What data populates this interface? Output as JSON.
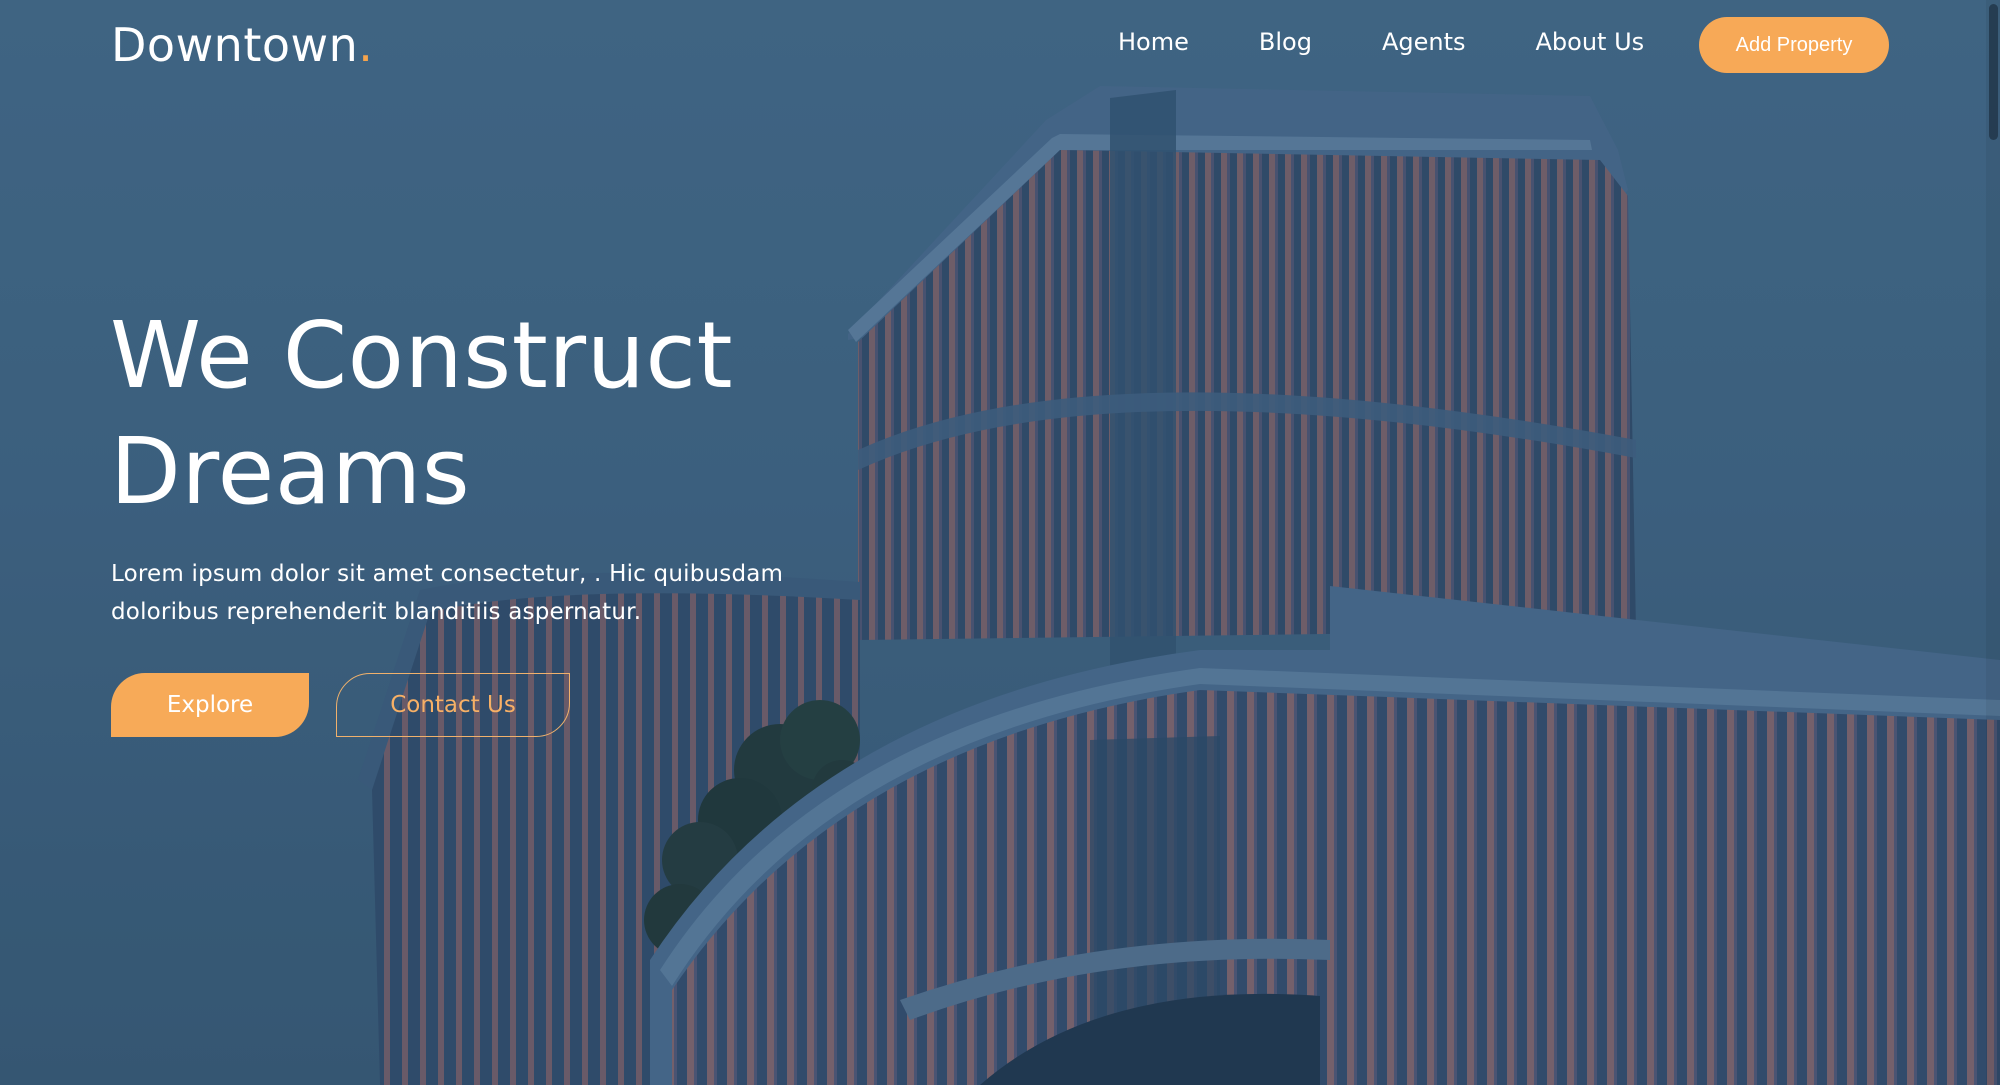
{
  "brand": {
    "name": "Downtown",
    "dot": ".",
    "accent_color": "#f6a44c"
  },
  "nav": {
    "items": [
      {
        "label": "Home"
      },
      {
        "label": "Blog"
      },
      {
        "label": "Agents"
      },
      {
        "label": "About Us"
      }
    ],
    "cta_label": "Add Property"
  },
  "hero": {
    "title_line1": "We Construct",
    "title_line2": "Dreams",
    "description_line1": "Lorem ipsum dolor sit amet consectetur, . Hic quibusdam",
    "description_line2": "doloribus reprehenderit blanditiis aspernatur.",
    "primary_button": "Explore",
    "secondary_button": "Contact Us"
  },
  "colors": {
    "overlay": "#426786",
    "accent": "#f7aa58"
  },
  "background": {
    "icon": "building-photo-background"
  }
}
